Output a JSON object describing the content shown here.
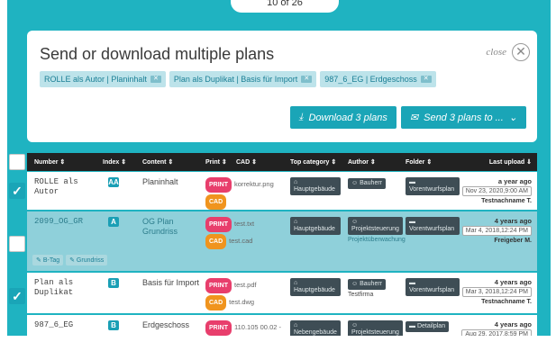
{
  "pager": "10 of 26",
  "modal": {
    "title": "Send or download multiple plans",
    "close_label": "close",
    "tags": [
      "ROLLE als Autor | Planinhalt",
      "Plan als Duplikat | Basis für Import",
      "987_6_EG | Erdgeschoss"
    ],
    "download_label": "Download 3 plans",
    "send_label": "Send 3 plans to ..."
  },
  "table": {
    "headers": {
      "number": "Number ⇕",
      "index": "Index ⇕",
      "content": "Content ⇕",
      "print": "Print ⇕",
      "cad": "CAD ⇕",
      "top_category": "Top category ⇕",
      "author": "Author ⇕",
      "folder": "Folder ⇕",
      "last_upload": "Last upload ⇓"
    },
    "rows": [
      {
        "number": "ROLLE als Autor",
        "index": "AA",
        "content": "Planinhalt",
        "print_badge": "PRINT",
        "print_file": "korrektur.png",
        "cad_badge": "CAD",
        "cad_file": "",
        "category": "Hauptgebäude",
        "author_chip": "Bauherr",
        "author_sub": "",
        "folder": "Vorentwurfsplan",
        "upload_ago": "a year ago",
        "upload_date": "Nov 23, 2020,9:00 AM",
        "upload_user": "Testnachname T.",
        "selected": true
      },
      {
        "number": "2099_OG_GR",
        "index": "A",
        "content": "OG Plan Grundriss",
        "print_badge": "PRINT",
        "print_file": "test.txt",
        "cad_badge": "CAD",
        "cad_file": "test.cad",
        "category": "Hauptgebäude",
        "author_chip": "Projektsteuerung",
        "author_sub": "Projektüberwachung",
        "folder": "Vorentwurfsplan",
        "upload_ago": "4 years ago",
        "upload_date": "Mar 4, 2018,12:24 PM",
        "upload_user": "Freigeber M.",
        "selected": false,
        "subtags": [
          "B-Tag",
          "Grundriss"
        ]
      },
      {
        "number": "Plan als Duplikat",
        "index": "B",
        "content": "Basis für Import",
        "print_badge": "PRINT",
        "print_file": "test.pdf",
        "cad_badge": "CAD",
        "cad_file": "test.dwg",
        "category": "Hauptgebäude",
        "author_chip": "Bauherr",
        "author_sub": "Testfirma",
        "folder": "Vorentwurfsplan",
        "upload_ago": "4 years ago",
        "upload_date": "Mar 3, 2018,12:24 PM",
        "upload_user": "Testnachname T.",
        "selected": true
      },
      {
        "number": "987_6_EG",
        "index": "B",
        "content": "Erdgeschoss",
        "print_badge": "PRINT",
        "print_file": "110.105 00.02 - Grundrisse.pdf",
        "cad_badge": "",
        "cad_file": "",
        "category": "Nebengebäude",
        "author_chip": "Projektsteuerung",
        "author_sub": "",
        "folder": "Detailplan",
        "upload_ago": "4 years ago",
        "upload_date": "Aug 29, 2017,8:59 PM",
        "upload_user": "",
        "selected": false
      }
    ]
  },
  "colors": {
    "teal": "#1fb3c1",
    "button": "#1aa5b7",
    "print": "#e83e6c",
    "cad": "#f0941e"
  }
}
